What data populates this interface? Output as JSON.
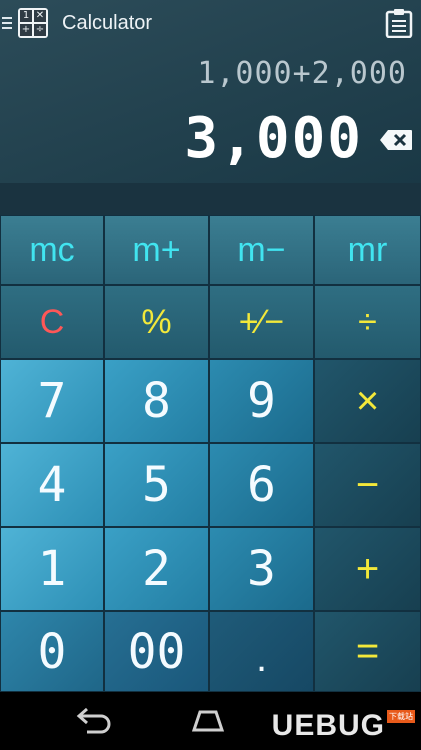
{
  "app": {
    "title": "Calculator",
    "icon_glyphs": [
      "1",
      "✕",
      "+",
      "÷"
    ]
  },
  "display": {
    "expression": "1,000+2,000",
    "result": "3,000"
  },
  "keys": {
    "mc": "mc",
    "mplus": "m+",
    "mminus": "m−",
    "mr": "mr",
    "clear": "C",
    "percent": "%",
    "sign": "+∕−",
    "divide": "÷",
    "seven": "7",
    "eight": "8",
    "nine": "9",
    "multiply": "×",
    "four": "4",
    "five": "5",
    "six": "6",
    "minus": "−",
    "one": "1",
    "two": "2",
    "three": "3",
    "plus": "+",
    "zero": "0",
    "double_zero": "00",
    "decimal": ".",
    "equals": "="
  },
  "watermark": {
    "text": "UEBUG",
    "badge": "下载站"
  },
  "colors": {
    "memory_text": "#41e4f0",
    "operator_text": "#f3e83a",
    "clear_text": "#ff5757"
  },
  "icons": {
    "menu": "hamburger-icon",
    "history": "clipboard-icon",
    "backspace": "backspace-icon",
    "nav_back": "back-arrow-icon",
    "nav_home": "home-icon"
  }
}
